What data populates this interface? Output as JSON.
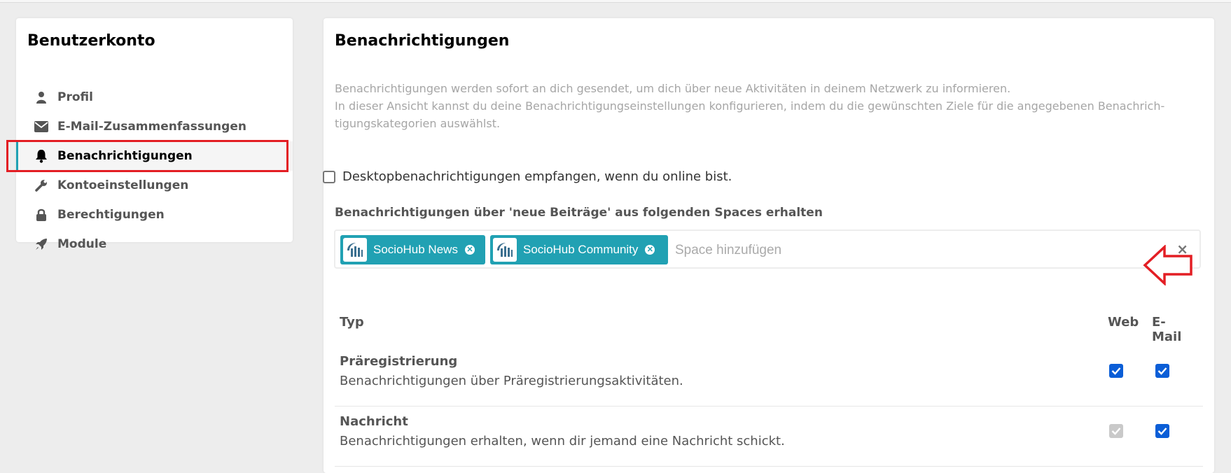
{
  "sidebar": {
    "title": "Benutzerkonto",
    "items": [
      {
        "label": "Profil",
        "icon": "user-icon"
      },
      {
        "label": "E-Mail-Zusammenfassungen",
        "icon": "envelope-icon"
      },
      {
        "label": "Benachrichtigungen",
        "icon": "bell-icon",
        "active": true
      },
      {
        "label": "Kontoeinstellungen",
        "icon": "wrench-icon"
      },
      {
        "label": "Berechtigungen",
        "icon": "lock-icon"
      },
      {
        "label": "Module",
        "icon": "rocket-icon"
      }
    ]
  },
  "main": {
    "title": "Benachrichtigungen",
    "description_line1": "Benachrichtigungen werden sofort an dich gesendet, um dich über neue Aktivitäten in deinem Netzwerk zu informieren.",
    "description_line2": "In dieser Ansicht kannst du deine Benachrichtigungseinstellungen konfigurieren, indem du die gewünschten Ziele für die angegebenen Benachrich-tigungskategorien auswählst.",
    "desktop_label": "Desktopbenachrichtigungen empfangen, wenn du online bist.",
    "desktop_checked": false,
    "spaces_label": "Benachrichtigungen über 'neue Beiträge' aus folgenden Spaces erhalten",
    "spaces": [
      {
        "name": "SocioHub News"
      },
      {
        "name": "SocioHub Community"
      }
    ],
    "space_placeholder": "Space hinzufügen",
    "clear_symbol": "×",
    "table": {
      "col_type": "Typ",
      "col_web": "Web",
      "col_email": "E-Mail",
      "rows": [
        {
          "title": "Präregistrierung",
          "desc": "Benachrichtigungen über Präregistrierungsaktivitäten.",
          "web": true,
          "web_disabled": false,
          "email": true
        },
        {
          "title": "Nachricht",
          "desc": "Benachrichtigungen erhalten, wenn dir jemand eine Nachricht schickt.",
          "web": true,
          "web_disabled": true,
          "email": true
        }
      ]
    }
  },
  "colors": {
    "accent": "#21a1b3",
    "checkbox": "#0b5ed7",
    "annotation": "#e31e24"
  }
}
